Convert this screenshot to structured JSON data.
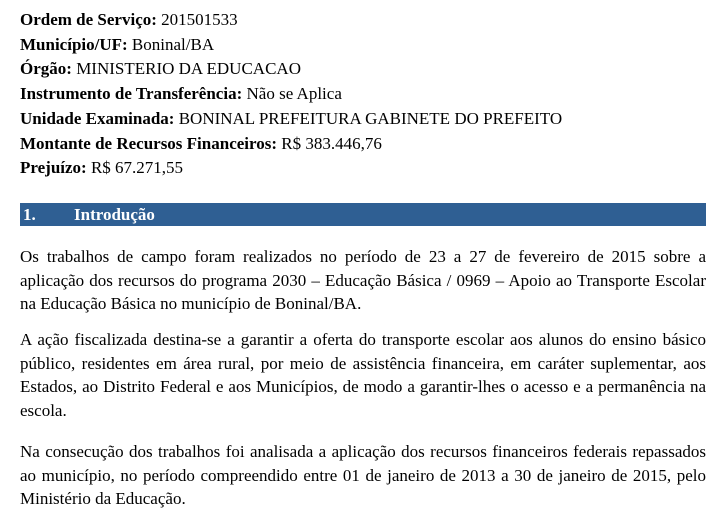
{
  "header_fields": [
    {
      "label": "Ordem de Serviço:",
      "value": " 201501533"
    },
    {
      "label": "Município/UF:",
      "value": " Boninal/BA"
    },
    {
      "label": "Órgão:",
      "value": " MINISTERIO DA EDUCACAO"
    },
    {
      "label": "Instrumento de Transferência:",
      "value": " Não se Aplica"
    },
    {
      "label": "Unidade Examinada:",
      "value": " BONINAL PREFEITURA GABINETE DO PREFEITO"
    },
    {
      "label": "Montante de Recursos Financeiros:",
      "value": " R$ 383.446,76"
    },
    {
      "label": "Prejuízo:",
      "value": " R$ 67.271,55"
    }
  ],
  "section": {
    "number": "1.",
    "title": "Introdução",
    "bar_color": "#2f5f93"
  },
  "paragraphs": [
    "Os trabalhos de campo foram realizados no período de 23 a 27 de fevereiro de 2015 sobre a aplicação dos recursos do programa 2030 – Educação Básica / 0969 – Apoio ao Transporte Escolar na Educação Básica no município de Boninal/BA.",
    "A ação fiscalizada destina-se a garantir a oferta do transporte escolar aos alunos do ensino básico público, residentes em área rural, por meio de assistência financeira, em caráter suplementar, aos Estados, ao Distrito Federal e aos Municípios, de modo a garantir-lhes o acesso e a permanência na escola.",
    "Na consecução dos trabalhos foi analisada a aplicação dos recursos financeiros federais repassados ao município, no período compreendido entre 01 de janeiro de 2013 a 30 de janeiro de 2015, pelo Ministério da Educação."
  ]
}
